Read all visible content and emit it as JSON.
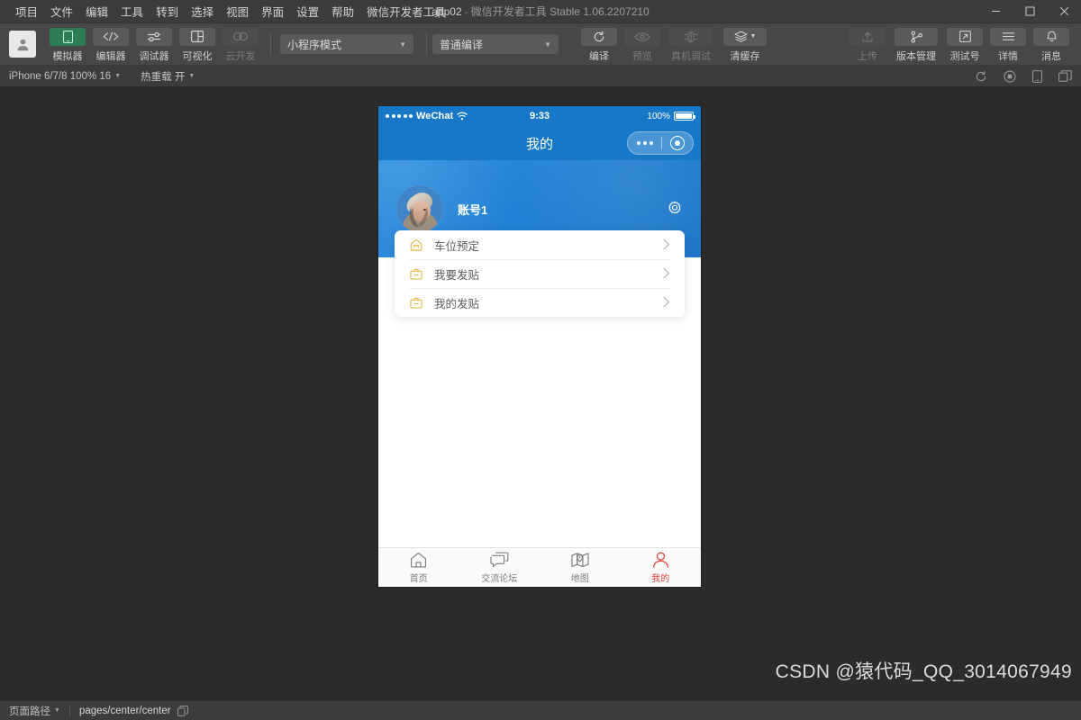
{
  "window": {
    "title_app": "app02",
    "title_sep": "-",
    "title_sub": "微信开发者工具 Stable 1.06.2207210",
    "minimize": "—",
    "maximize": "□",
    "close": "✕"
  },
  "menubar": {
    "items": [
      {
        "label": "项目"
      },
      {
        "label": "文件"
      },
      {
        "label": "编辑"
      },
      {
        "label": "工具"
      },
      {
        "label": "转到"
      },
      {
        "label": "选择"
      },
      {
        "label": "视图"
      },
      {
        "label": "界面"
      },
      {
        "label": "设置"
      },
      {
        "label": "帮助"
      },
      {
        "label": "微信开发者工具"
      }
    ]
  },
  "toolbar": {
    "left_buttons": [
      {
        "label": "模拟器",
        "icon": "phone-icon",
        "state": "active"
      },
      {
        "label": "编辑器",
        "icon": "code-icon",
        "state": "normal"
      },
      {
        "label": "调试器",
        "icon": "sliders-icon",
        "state": "normal"
      },
      {
        "label": "可视化",
        "icon": "layout-icon",
        "state": "normal"
      },
      {
        "label": "云开发",
        "icon": "cloud-icon",
        "state": "disabled"
      }
    ],
    "mode_select": "小程序模式",
    "compile_select": "普通编译",
    "center_buttons": [
      {
        "label": "编译",
        "icon": "refresh-icon",
        "state": "normal"
      },
      {
        "label": "预览",
        "icon": "eye-icon",
        "state": "disabled"
      },
      {
        "label": "真机调试",
        "icon": "device-debug-icon",
        "state": "disabled"
      },
      {
        "label": "清缓存",
        "icon": "layers-icon",
        "state": "normal"
      }
    ],
    "right_buttons": [
      {
        "label": "上传",
        "icon": "upload-icon",
        "state": "disabled"
      },
      {
        "label": "版本管理",
        "icon": "git-branch-icon",
        "state": "normal"
      },
      {
        "label": "测试号",
        "icon": "external-link-icon",
        "state": "normal"
      },
      {
        "label": "详情",
        "icon": "menu-lines-icon",
        "state": "normal"
      },
      {
        "label": "消息",
        "icon": "bell-icon",
        "state": "normal"
      }
    ]
  },
  "subbar": {
    "device": "iPhone 6/7/8 100% 16",
    "hotreload": "热重载 开",
    "icons": [
      {
        "name": "refresh-icon"
      },
      {
        "name": "record-icon"
      },
      {
        "name": "phone-icon"
      },
      {
        "name": "windows-icon"
      }
    ]
  },
  "simulator": {
    "status": {
      "carrier": "WeChat",
      "time": "9:33",
      "battery_pct": "100%"
    },
    "nav": {
      "title": "我的"
    },
    "profile": {
      "account_name": "账号1",
      "settings_icon": "gear-icon"
    },
    "menu": [
      {
        "label": "车位预定",
        "icon": "garage-icon"
      },
      {
        "label": "我要发贴",
        "icon": "briefcase-icon"
      },
      {
        "label": "我的发贴",
        "icon": "briefcase-icon"
      }
    ],
    "tabs": [
      {
        "label": "首页",
        "icon": "home-icon",
        "active": false
      },
      {
        "label": "交流论坛",
        "icon": "chat-icon",
        "active": false
      },
      {
        "label": "地图",
        "icon": "map-icon",
        "active": false
      },
      {
        "label": "我的",
        "icon": "person-icon",
        "active": true
      }
    ]
  },
  "bottombar": {
    "path_label": "页面路径",
    "path_value": "pages/center/center",
    "copy_icon": "copy-icon"
  },
  "watermark": "CSDN @猿代码_QQ_3014067949",
  "colors": {
    "accent_blue": "#1878c8",
    "hero_blue": "#2f8fe0",
    "tab_active_red": "#e8413c",
    "icon_gold": "#e3b33c",
    "chrome_dark": "#3c3c3c",
    "toolbar_gray": "#474747",
    "stage_bg": "#2b2b2b",
    "active_green": "#2e7d52"
  }
}
